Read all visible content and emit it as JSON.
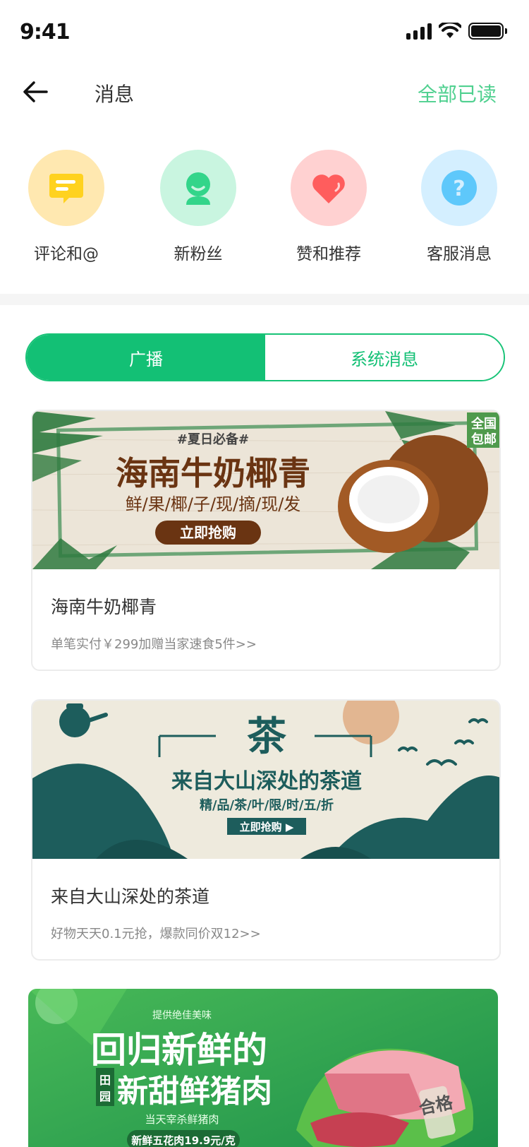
{
  "status": {
    "time": "9:41"
  },
  "nav": {
    "title": "消息",
    "mark_all_read": "全部已读"
  },
  "categories": [
    {
      "label": "评论和@",
      "icon": "comment-icon",
      "bg": "#ffe8b0",
      "fg": "#ffd21f"
    },
    {
      "label": "新粉丝",
      "icon": "new-follower-icon",
      "bg": "#c9f5e0",
      "fg": "#33d58a"
    },
    {
      "label": "赞和推荐",
      "icon": "heart-icon",
      "bg": "#ffd1d1",
      "fg": "#ff5d5d"
    },
    {
      "label": "客服消息",
      "icon": "help-icon",
      "bg": "#d4efff",
      "fg": "#5ec8fb"
    }
  ],
  "tabs": {
    "broadcast": "广播",
    "system": "系统消息"
  },
  "messages": [
    {
      "title": "海南牛奶椰青",
      "subtitle": "单笔实付￥299加赠当家速食5件>>",
      "banner": {
        "tag": "#夏日必备#",
        "headline": "海南牛奶椰青",
        "line": "鲜/果/椰/子/现/摘/现/发",
        "button": "立即抢购",
        "badge_top": "全国",
        "badge_bottom": "包邮"
      }
    },
    {
      "title": "来自大山深处的茶道",
      "subtitle": "好物天天0.1元抢，爆款同价双12>>",
      "banner": {
        "big": "茶",
        "headline": "来自大山深处的茶道",
        "line": "精/品/茶/叶/限/时/五/折",
        "button": "立即抢购 ▶"
      }
    },
    {
      "title": "",
      "subtitle": "",
      "banner": {
        "tag": "提供绝佳美味",
        "headline1": "回归新鲜的",
        "mini_top": "田",
        "mini_bottom": "园",
        "headline2": "新甜鲜猪肉",
        "line": "当天宰杀鲜猪肉",
        "price": "新鲜五花肉19.9元/克",
        "stamp": "合格"
      }
    }
  ]
}
